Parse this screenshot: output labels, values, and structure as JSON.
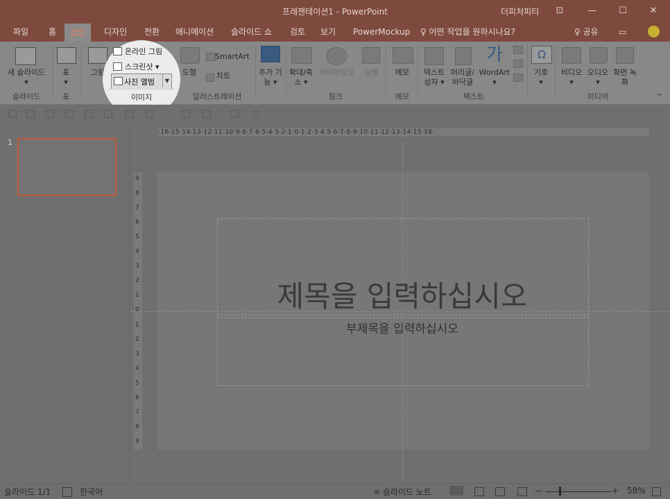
{
  "window": {
    "title": "프레젠테이션1 - PowerPoint",
    "account": "더피처피티",
    "min_glyph": "—",
    "max_glyph": "☐",
    "close_glyph": "✕",
    "restore_glyph": "⊡"
  },
  "tabs": [
    "파일",
    "홈",
    "삽입",
    "디자인",
    "전환",
    "애니메이션",
    "슬라이드 쇼",
    "검토",
    "보기",
    "PowerMockup"
  ],
  "active_tab": "삽입",
  "tell_me": "♀ 어떤 작업을 원하시나요?",
  "share": "♀ 공유",
  "ribbon": {
    "new_slide": "새 슬라이드",
    "new_slide_caret": "▾",
    "table": "표",
    "table_caret": "▾",
    "pictures": "그림",
    "online_pictures": "온라인 그림",
    "screenshot": "스크린샷 ▾",
    "photo_album": "사진 앨범",
    "shapes": "도형",
    "smartart": "SmartArt",
    "chart": "차트",
    "addins": "추가 기능 ▾",
    "zoom": "확대/축소 ▾",
    "hyperlink": "하이퍼링크",
    "action": "실행",
    "comment": "메모",
    "textbox": "텍스트 상자 ▾",
    "header_footer": "머리글/바닥글",
    "wordart": "WordArt",
    "wordart_caret": "▾",
    "symbols": "기호",
    "symbols_caret": "▾",
    "symbol_glyph": "Ω",
    "video": "비디오",
    "audio": "오디오",
    "screen_recording": "화면 녹화",
    "media_caret": "▾",
    "collapse_glyph": "^"
  },
  "groups": {
    "slides": "슬라이드",
    "tables": "표",
    "images": "이미지",
    "illustrations": "일러스트레이션",
    "links": "링크",
    "comments": "메모",
    "text": "텍스트",
    "media": "미디어"
  },
  "slide_pane": {
    "number": "1"
  },
  "ruler_h": "·16·15·14·13·12·11·10·9·8·7·6·5·4·3·2·1·0·1·2·3·4·5·6·7·8·9·10·11·12·13·14·15·16·",
  "ruler_v": [
    "9",
    "8",
    "7",
    "6",
    "5",
    "4",
    "3",
    "2",
    "1",
    "0",
    "1",
    "2",
    "3",
    "4",
    "5",
    "6",
    "7",
    "8",
    "9"
  ],
  "slide": {
    "title_placeholder": "제목을 입력하십시오",
    "subtitle_placeholder": "부제목을 입력하십시오"
  },
  "status": {
    "slide_count": "슬라이드 1/1",
    "language": "한국어",
    "notes": "≐ 슬라이드 노트",
    "zoom_minus": "—",
    "zoom_plus": "+",
    "zoom": "58%"
  }
}
